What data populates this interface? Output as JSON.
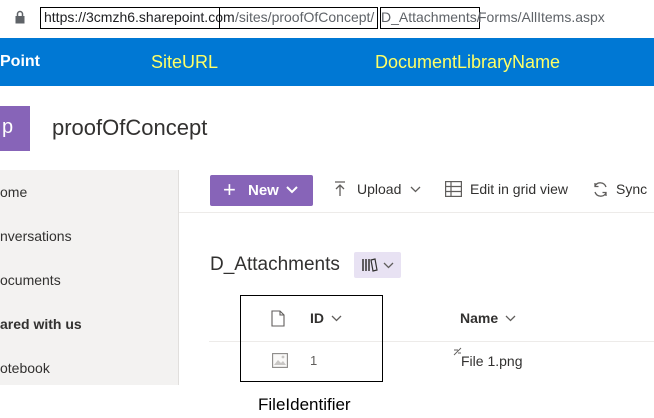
{
  "browser": {
    "url_host": "https://3cmzh6.sharepoint.com",
    "url_site_path": "/sites/proofOfConcept/",
    "url_library": "D_Attachments/",
    "url_tail": "Forms/AllItems.aspx"
  },
  "suite_bar": {
    "brand": "Point",
    "annotation_site": "SiteURL",
    "annotation_library": "DocumentLibraryName",
    "annotation_color": "#ffff66",
    "bg_color": "#0078d4"
  },
  "site": {
    "logo_letter": "p",
    "logo_color": "#8764b8",
    "title": "proofOfConcept"
  },
  "left_nav": {
    "items": [
      {
        "label": "ome"
      },
      {
        "label": "nversations"
      },
      {
        "label": "ocuments"
      },
      {
        "label": "ared with us"
      },
      {
        "label": "otebook"
      }
    ]
  },
  "command_bar": {
    "new_label": "New",
    "upload_label": "Upload",
    "grid_label": "Edit in grid view",
    "sync_label": "Sync"
  },
  "library": {
    "title": "D_Attachments",
    "columns": {
      "id": "ID",
      "name": "Name"
    },
    "rows": [
      {
        "id": "1",
        "name": "File 1.png",
        "icon": "image-file-icon"
      }
    ]
  },
  "annotations": {
    "file_identifier": "FileIdentifier"
  }
}
